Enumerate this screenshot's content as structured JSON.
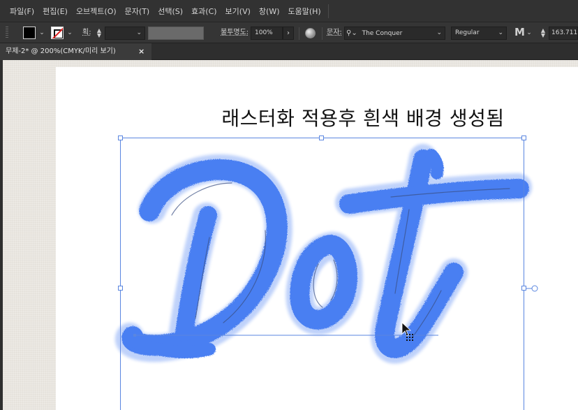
{
  "menu": {
    "items": [
      "파일(F)",
      "편집(E)",
      "오브젝트(O)",
      "문자(T)",
      "선택(S)",
      "효과(C)",
      "보기(V)",
      "창(W)",
      "도움말(H)"
    ]
  },
  "control": {
    "stroke_label": "획:",
    "opacity_label": "불투명도:",
    "opacity_value": "100%",
    "char_label": "문자:",
    "font_family": "The Conquer",
    "font_style": "Regular",
    "font_size": "163.711"
  },
  "document": {
    "tab_title": "무제-2* @ 200%(CMYK/미리 보기)",
    "close_glyph": "×"
  },
  "artboard": {
    "title_text": "래스터화 적용후 흰색 배경 생성됨",
    "art_text": "Dot"
  },
  "colors": {
    "letter_fill": "#4a7ff2",
    "selection": "#5a86e0",
    "menu_bg": "#323232",
    "control_bg": "#353535"
  },
  "icons": {
    "fill_swatch": "fill-swatch-icon",
    "stroke_swatch": "stroke-none-swatch-icon",
    "globe": "globe-icon",
    "search": "search-icon",
    "cursor": "arrow-cursor-icon"
  }
}
